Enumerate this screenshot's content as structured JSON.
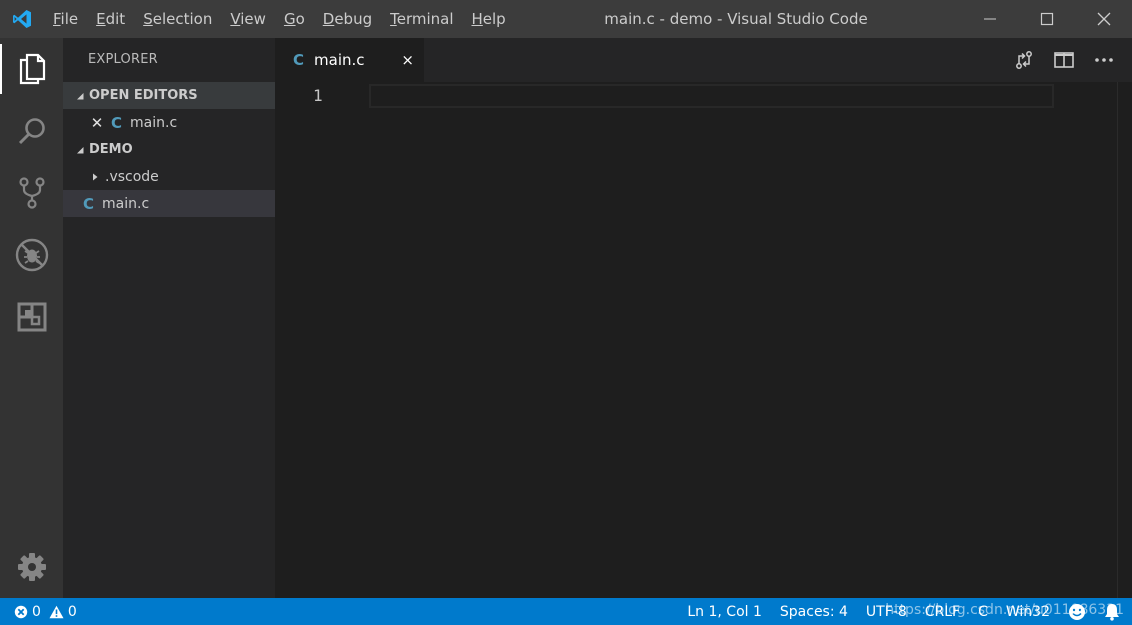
{
  "window": {
    "title": "main.c - demo - Visual Studio Code"
  },
  "menu": [
    {
      "label": "File"
    },
    {
      "label": "Edit"
    },
    {
      "label": "Selection"
    },
    {
      "label": "View"
    },
    {
      "label": "Go"
    },
    {
      "label": "Debug"
    },
    {
      "label": "Terminal"
    },
    {
      "label": "Help"
    }
  ],
  "activity_bar": {
    "items": [
      "explorer-icon",
      "search-icon",
      "source-control-icon",
      "debug-icon",
      "extensions-icon"
    ],
    "settings": "gear-icon"
  },
  "sidebar": {
    "title": "EXPLORER",
    "open_editors": {
      "header": "OPEN EDITORS",
      "files": [
        {
          "icon": "C",
          "name": "main.c"
        }
      ]
    },
    "workspace": {
      "header": "DEMO",
      "items": [
        {
          "name": ".vscode",
          "type": "folder"
        },
        {
          "icon": "C",
          "name": "main.c",
          "type": "file"
        }
      ]
    }
  },
  "editor": {
    "tab": {
      "icon": "C",
      "label": "main.c",
      "close": "×"
    },
    "line_numbers": [
      "1"
    ]
  },
  "status_bar": {
    "errors": "0",
    "warnings": "0",
    "position": "Ln 1, Col 1",
    "spaces": "Spaces: 4",
    "encoding": "UTF-8",
    "eol": "CRLF",
    "language": "C",
    "platform": "Win32",
    "watermark": "https://blog.csdn.net/u011086331"
  },
  "colors": {
    "accent": "#007acc",
    "c_icon": "#519aba",
    "logo": "#23a9f2"
  }
}
